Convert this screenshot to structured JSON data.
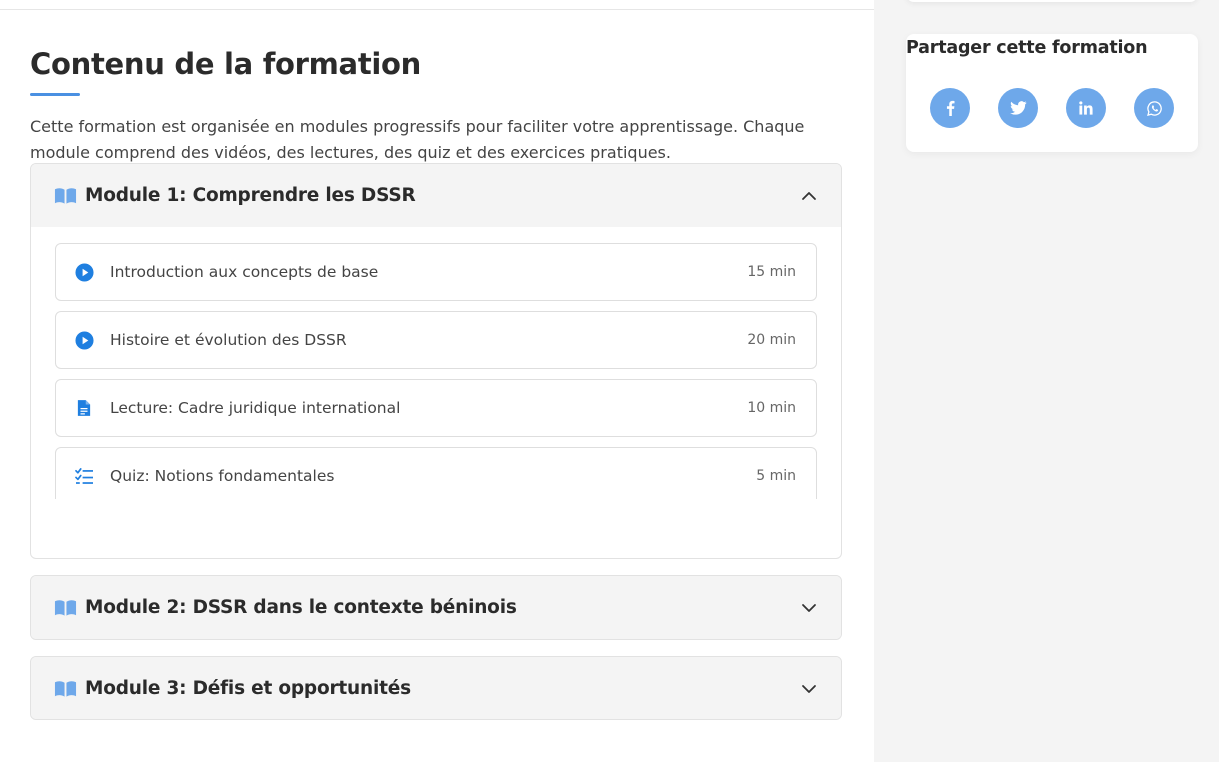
{
  "section": {
    "title": "Contenu de la formation",
    "intro": "Cette formation est organisée en modules progressifs pour faciliter votre apprentissage. Chaque module comprend des vidéos, des lectures, des quiz et des exercices pratiques."
  },
  "modules": [
    {
      "title": "Module 1: Comprendre les DSSR",
      "expanded": true,
      "lessons": [
        {
          "icon": "play-circle-icon",
          "title": "Introduction aux concepts de base",
          "duration": "15 min"
        },
        {
          "icon": "play-circle-icon",
          "title": "Histoire et évolution des DSSR",
          "duration": "20 min"
        },
        {
          "icon": "document-icon",
          "title": "Lecture: Cadre juridique international",
          "duration": "10 min"
        },
        {
          "icon": "checklist-icon",
          "title": "Quiz: Notions fondamentales",
          "duration": "5 min"
        }
      ]
    },
    {
      "title": "Module 2: DSSR dans le contexte béninois",
      "expanded": false
    },
    {
      "title": "Module 3: Défis et opportunités",
      "expanded": false
    }
  ],
  "sidebar": {
    "share_title": "Partager cette formation",
    "socials": [
      {
        "name": "facebook-icon",
        "glyph": "f"
      },
      {
        "name": "twitter-icon",
        "glyph": "t"
      },
      {
        "name": "linkedin-icon",
        "glyph": "in"
      },
      {
        "name": "whatsapp-icon",
        "glyph": "w"
      }
    ]
  },
  "colors": {
    "accent": "#1f7fe0",
    "accent_light": "#6ea8ea",
    "header_bg": "#f4f4f4"
  }
}
